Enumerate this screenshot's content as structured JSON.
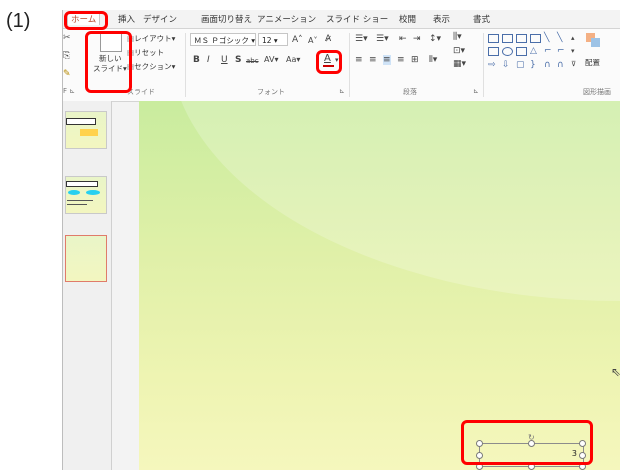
{
  "step_label": "(1)",
  "tabs": [
    "ホーム",
    "挿入",
    "デザイン",
    "画面切り替え",
    "アニメーション",
    "スライド ショー",
    "校閲",
    "表示",
    "書式"
  ],
  "ribbon": {
    "new_slide_line1": "新しい",
    "new_slide_line2": "スライド",
    "layout": "レイアウト",
    "reset": "リセット",
    "section": "セクション",
    "slide_group": "スライド",
    "font_name": "ＭＳ Ｐゴシック",
    "font_size": "12",
    "bold": "B",
    "italic": "I",
    "underline": "U",
    "shadow": "S",
    "strike": "abc",
    "spacing": "AV",
    "case": "Aa",
    "font_color": "A",
    "font_group": "フォント",
    "paragraph_group": "段落",
    "arrange": "配置",
    "shapes_group": "図形描画"
  },
  "slide": {
    "slide_number": "3"
  },
  "colors": {
    "highlight": "#ff0000",
    "home_tab": "#b7472a",
    "font_color_bar": "#cc0000"
  }
}
